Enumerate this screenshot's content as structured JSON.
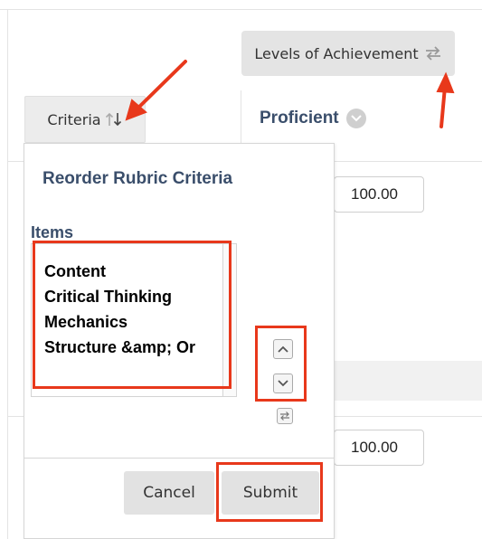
{
  "header": {
    "levels_label": "Levels of Achievement",
    "criteria_label": "Criteria"
  },
  "column": {
    "proficient_label": "Proficient"
  },
  "scores": [
    "100.00",
    "100.00"
  ],
  "reorder_popup": {
    "title": "Reorder Rubric Criteria",
    "items_label": "Items",
    "items": [
      "Content",
      "Critical Thinking",
      "Mechanics",
      "Structure &amp; Or"
    ],
    "cancel_label": "Cancel",
    "submit_label": "Submit"
  },
  "annotation_color": "#e8381b"
}
